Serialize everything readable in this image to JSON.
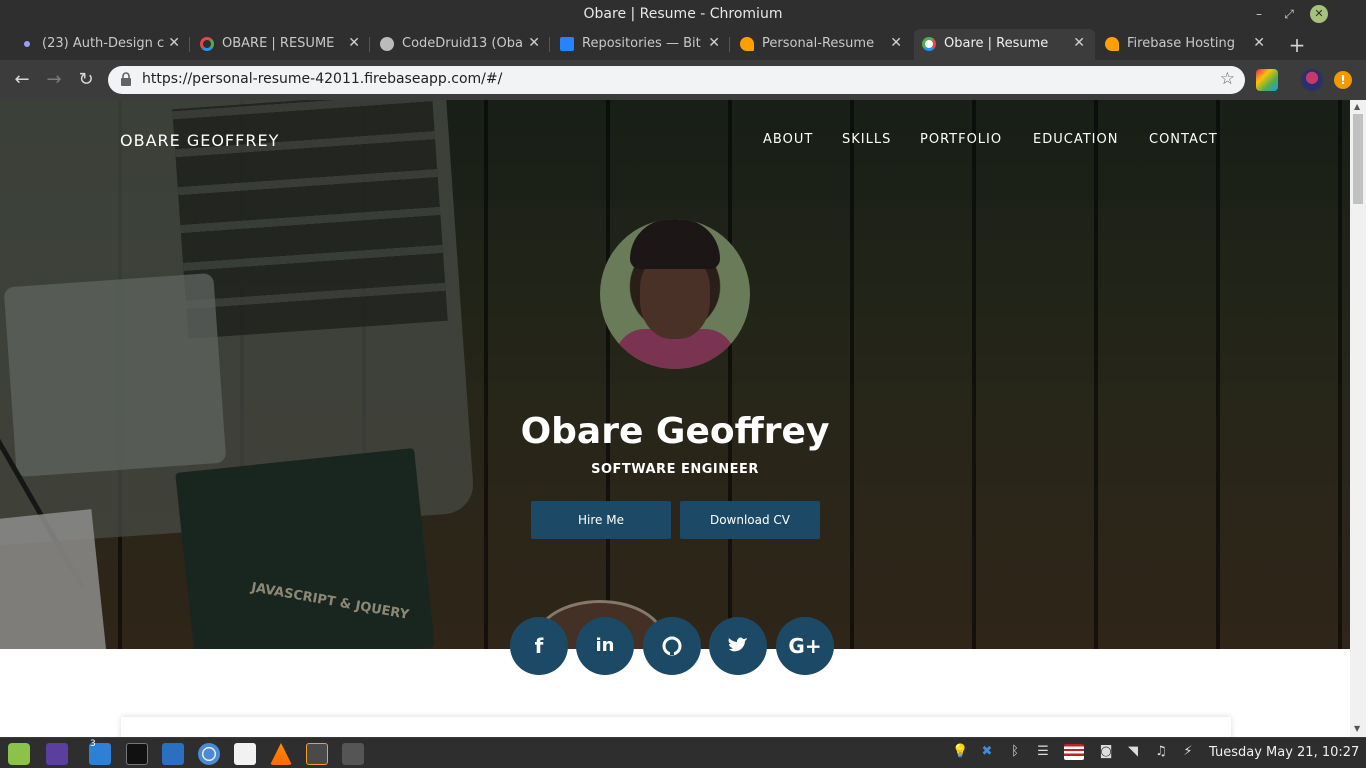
{
  "window": {
    "title": "Obare | Resume - Chromium"
  },
  "tabs": [
    {
      "label": "(23) Auth-Design c",
      "icon": "dot-icon",
      "color": "#9aa0ff"
    },
    {
      "label": "OBARE | RESUME",
      "icon": "spinner-icon",
      "color": "#e04a4a"
    },
    {
      "label": "CodeDruid13 (Oba",
      "icon": "github-icon",
      "color": "#bbbbbb"
    },
    {
      "label": "Repositories — Bit",
      "icon": "bitbucket-icon",
      "color": "#2684ff"
    },
    {
      "label": "Personal-Resume",
      "icon": "firebase-icon",
      "color": "#ffa000"
    },
    {
      "label": "Obare | Resume",
      "icon": "spinner-icon",
      "color": "#4caf50",
      "active": true
    },
    {
      "label": "Firebase Hosting",
      "icon": "firebase-icon",
      "color": "#ffa000"
    }
  ],
  "toolbar": {
    "url": "https://personal-resume-42011.firebaseapp.com/#/"
  },
  "page": {
    "brand": "OBARE GEOFFREY",
    "menu": [
      "ABOUT",
      "SKILLS",
      "PORTFOLIO",
      "EDUCATION",
      "CONTACT"
    ],
    "name": "Obare Geoffrey",
    "role": "SOFTWARE ENGINEER",
    "buttons": {
      "hire": "Hire Me",
      "cv": "Download CV"
    },
    "social": [
      "facebook-icon",
      "linkedin-icon",
      "github-icon",
      "twitter-icon",
      "google-plus-icon"
    ],
    "book_text": "JAVASCRIPT & JQUERY",
    "accent_color": "#1c4a66"
  },
  "taskbar": {
    "files_badge": "3",
    "clock": "Tuesday May 21, 10:27"
  }
}
